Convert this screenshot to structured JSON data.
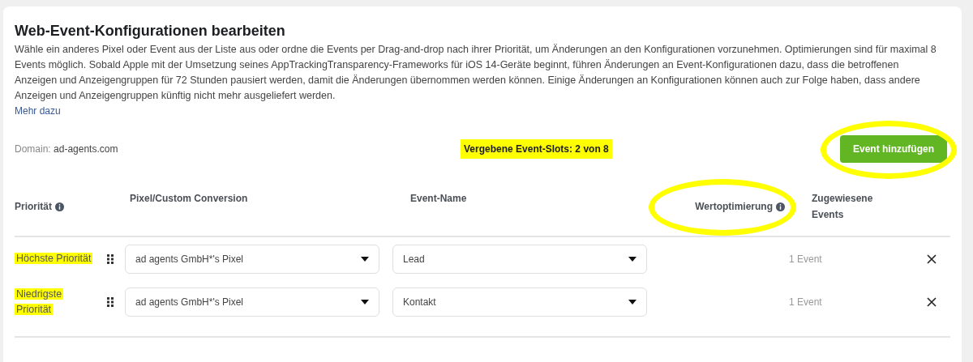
{
  "title": "Web-Event-Konfigurationen bearbeiten",
  "description": "Wähle ein anderes Pixel oder Event aus der Liste aus oder ordne die Events per Drag-and-drop nach ihrer Priorität, um Änderungen an den Konfigurationen vorzunehmen. Optimierungen sind für maximal 8 Events möglich. Sobald Apple mit der Umsetzung seines AppTrackingTransparency-Frameworks für iOS 14-Geräte beginnt, führen Änderungen an Event-Konfigurationen dazu, dass die betroffenen Anzeigen und Anzeigengruppen für 72 Stunden pausiert werden, damit die Änderungen übernommen werden können. Einige Änderungen an Konfigurationen können auch zur Folge haben, dass andere Anzeigen und Anzeigengruppen künftig nicht mehr ausgeliefert werden.",
  "more_link": "Mehr dazu",
  "domain": {
    "label": "Domain:",
    "value": "ad-agents.com"
  },
  "slots": {
    "text": "Vergebene Event-Slots: 2 von 8",
    "highlighted": true
  },
  "add_button": {
    "label": "Event hinzufügen",
    "highlighted": true
  },
  "columns": [
    {
      "label": "Priorität",
      "info": true,
      "highlighted": false
    },
    {
      "label": "Pixel/Custom Conversion",
      "info": false,
      "highlighted": false
    },
    {
      "label": "Event-Name",
      "info": false,
      "highlighted": false
    },
    {
      "label": "Wertoptimierung",
      "info": true,
      "highlighted": true
    },
    {
      "label": "Zugewiesene Events",
      "info": false,
      "highlighted": false
    }
  ],
  "rows": [
    {
      "priority": "Höchste Priorität",
      "highlighted": true,
      "pixel": "ad agents GmbH*'s Pixel",
      "event": "Lead",
      "assigned": "1 Event"
    },
    {
      "priority": "Niedrigste Priorität",
      "highlighted": true,
      "pixel": "ad agents GmbH*'s Pixel",
      "event": "Kontakt",
      "assigned": "1 Event"
    }
  ]
}
